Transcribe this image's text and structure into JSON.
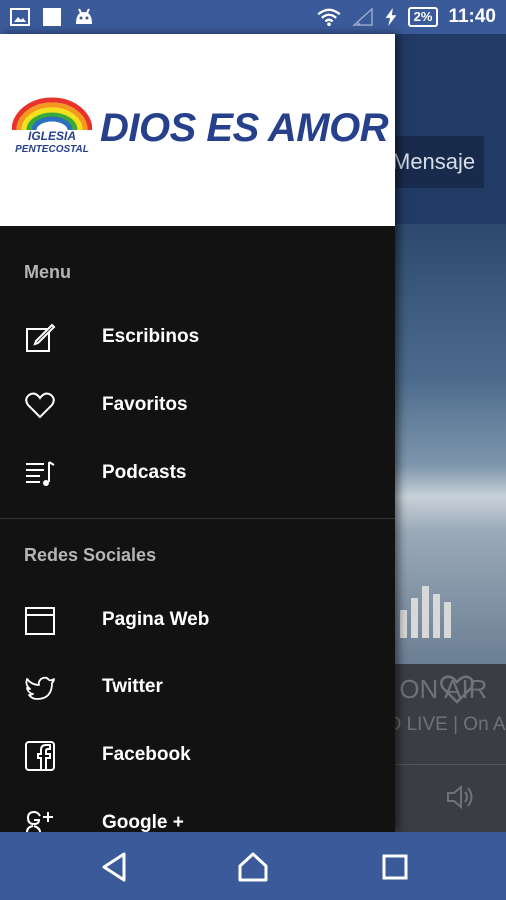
{
  "status_bar": {
    "battery": "2%",
    "time": "11:40",
    "icons": [
      "image-icon",
      "square-icon",
      "android-icon",
      "wifi-icon",
      "signal-icon",
      "charging-icon"
    ]
  },
  "main": {
    "mensaje_label": "Mensaje",
    "now_playing_title": "N VIVO | ON AIR",
    "now_playing_subtitle": "ino Más | Streaming HD LIVE | On AIR"
  },
  "drawer": {
    "logo": {
      "arc_text": "IGLESIA",
      "sub_text": "PENTECOSTAL",
      "title": "DIOS ES AMOR"
    },
    "menu_header": "Menu",
    "menu_items": [
      {
        "label": "Escribinos",
        "icon": "edit-icon"
      },
      {
        "label": "Favoritos",
        "icon": "heart-icon"
      },
      {
        "label": "Podcasts",
        "icon": "playlist-icon"
      }
    ],
    "social_header": "Redes Sociales",
    "social_items": [
      {
        "label": "Pagina Web",
        "icon": "browser-icon"
      },
      {
        "label": "Twitter",
        "icon": "twitter-icon"
      },
      {
        "label": "Facebook",
        "icon": "facebook-icon"
      },
      {
        "label": "Google +",
        "icon": "google-plus-icon"
      }
    ]
  },
  "nav_bar": {
    "buttons": [
      "back-icon",
      "home-icon",
      "recents-icon"
    ]
  },
  "colors": {
    "status_bar": "#3a5a99",
    "drawer_bg": "#121212",
    "logo_blue": "#27408b"
  }
}
